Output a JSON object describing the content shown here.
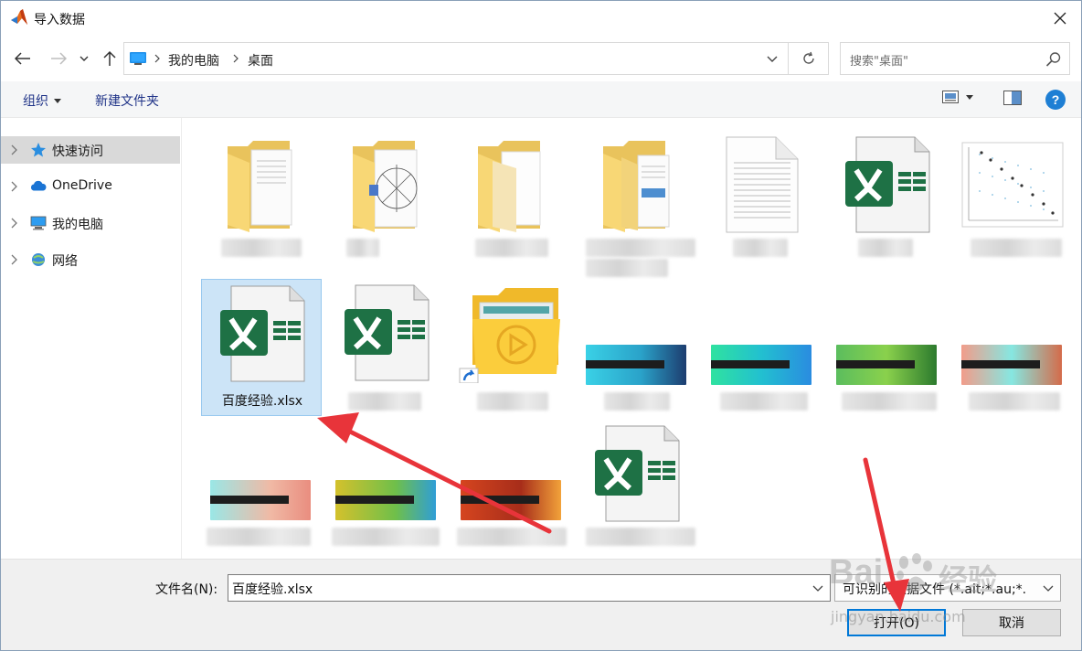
{
  "window": {
    "title": "导入数据",
    "close_glyph": "✕"
  },
  "nav": {
    "back_glyph": "←",
    "forward_glyph": "→",
    "recent_glyph": "⌄",
    "up_glyph": "↑",
    "breadcrumb": [
      "我的电脑",
      "桌面"
    ],
    "refresh_glyph": "↻",
    "search_placeholder": "搜索\"桌面\""
  },
  "toolbar": {
    "organize_label": "组织",
    "new_folder_label": "新建文件夹",
    "help_label": "?"
  },
  "sidebar": {
    "items": [
      {
        "label": "快速访问",
        "icon": "star-icon",
        "selected": true
      },
      {
        "label": "OneDrive",
        "icon": "cloud-icon",
        "selected": false
      },
      {
        "label": "我的电脑",
        "icon": "computer-icon",
        "selected": false
      },
      {
        "label": "网络",
        "icon": "network-icon",
        "selected": false
      }
    ]
  },
  "files": {
    "selected_name": "百度经验.xlsx"
  },
  "bottom": {
    "filename_label": "文件名(N):",
    "filename_value": "百度经验.xlsx",
    "filetype_value": "可识别的数据文件 (*.ait;*.au;*.",
    "open_label": "打开(O)",
    "cancel_label": "取消"
  },
  "watermark": {
    "brand": "Bai",
    "brand2": "经验",
    "url": "jingyan.baidu.com"
  },
  "colors": {
    "accent": "#0078d7",
    "selection_bg": "#cce4f7",
    "excel_green": "#1e7145",
    "folder_yellow": "#f8d775",
    "arrow_red": "#e8343a"
  }
}
